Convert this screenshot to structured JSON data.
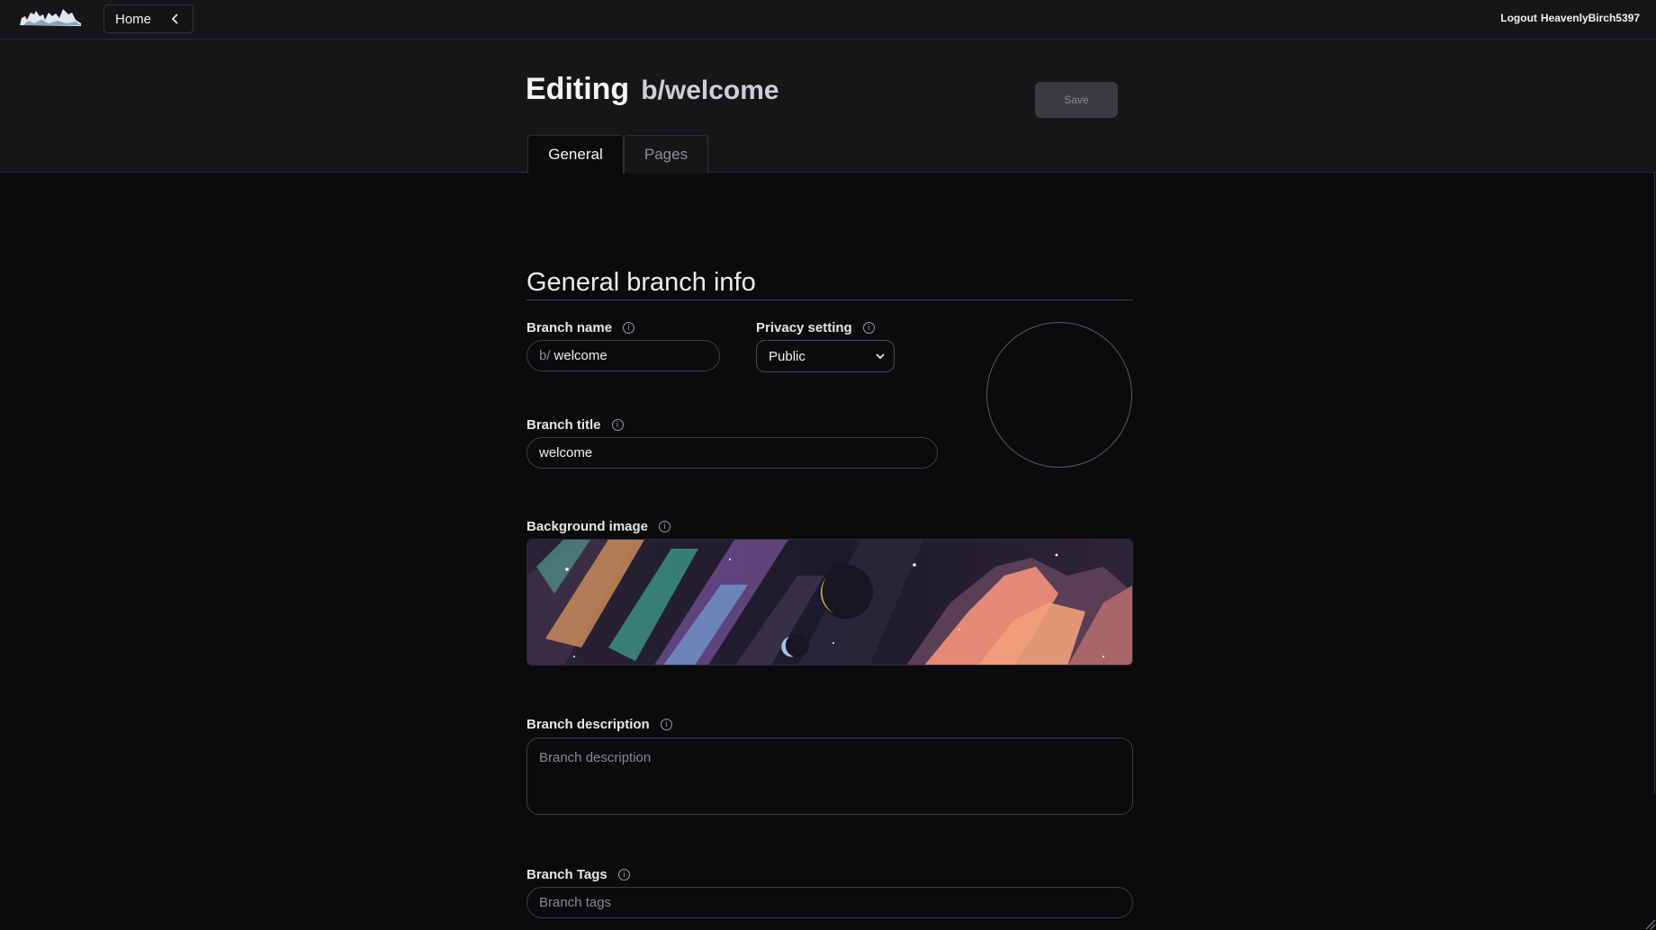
{
  "topbar": {
    "logo_icon": "cloud-logo-icon",
    "home_label": "Home",
    "home_chevron_icon": "chevron-left-icon",
    "logout_label": "Logout",
    "username": "HeavenlyBirch5397"
  },
  "header": {
    "title": "Editing",
    "branch": "b/welcome",
    "save_label": "Save",
    "tabs": [
      {
        "label": "General",
        "active": true
      },
      {
        "label": "Pages",
        "active": false
      }
    ]
  },
  "form": {
    "section_title": "General branch info",
    "branch_name": {
      "label": "Branch name",
      "prefix": "b/",
      "value": "welcome"
    },
    "privacy": {
      "label": "Privacy setting",
      "value": "Public"
    },
    "branch_title": {
      "label": "Branch title",
      "value": "welcome"
    },
    "background_image": {
      "label": "Background image"
    },
    "description": {
      "label": "Branch description",
      "placeholder": "Branch description"
    },
    "tags": {
      "label": "Branch Tags",
      "placeholder": "Branch tags"
    }
  },
  "colors": {
    "background": "#0b0b0e",
    "header": "#161619",
    "save_disabled": "#3a3a3f"
  }
}
